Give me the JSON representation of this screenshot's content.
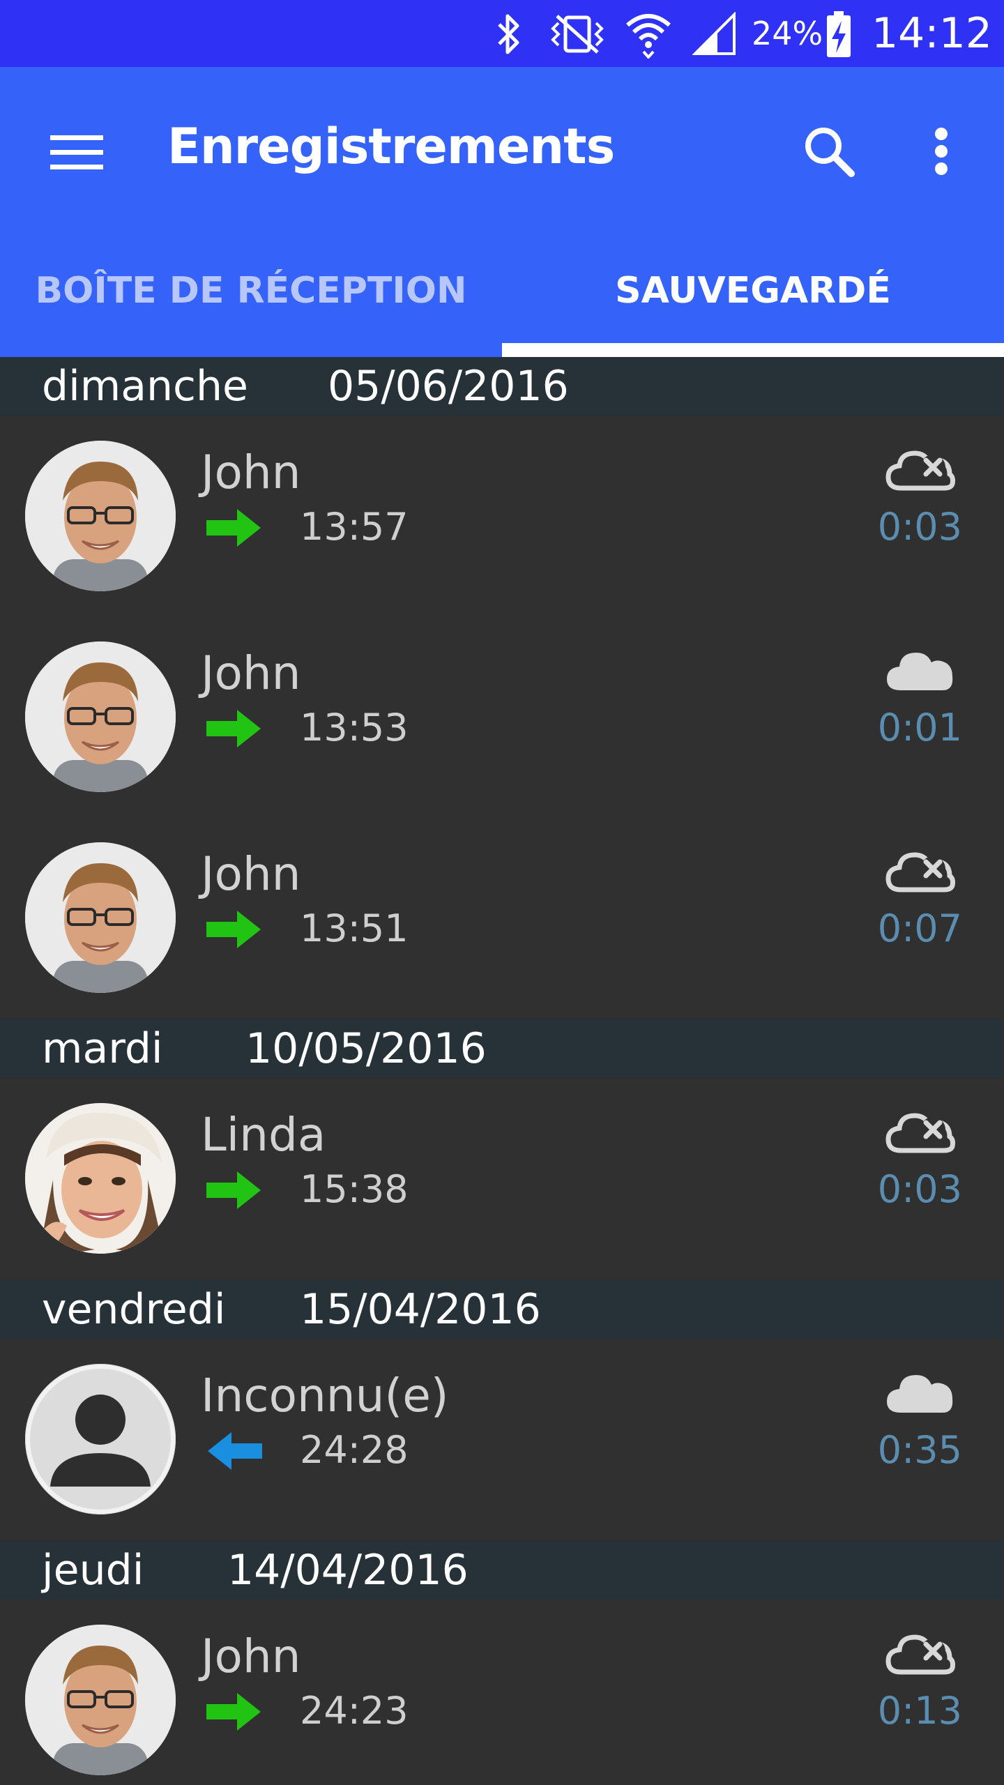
{
  "status_bar": {
    "battery": "24%",
    "time": "14:12",
    "icons": [
      "bluetooth-icon",
      "vibrate-icon",
      "wifi-icon",
      "signal-icon",
      "battery-charging-icon"
    ]
  },
  "app_bar": {
    "title": "Enregistrements",
    "icons": [
      "menu-icon",
      "search-icon",
      "more-vert-icon"
    ]
  },
  "tabs": [
    {
      "label": "BOÎTE DE RÉCEPTION",
      "active": false
    },
    {
      "label": "SAUVEGARDÉ",
      "active": true
    }
  ],
  "sections": [
    {
      "day": "dimanche",
      "date": "05/06/2016",
      "items": [
        {
          "name": "John",
          "direction": "outgoing",
          "time": "13:57",
          "cloud": "cloud-off-icon",
          "duration": "0:03"
        },
        {
          "name": "John",
          "direction": "outgoing",
          "time": "13:53",
          "cloud": "cloud-icon",
          "duration": "0:01"
        },
        {
          "name": "John",
          "direction": "outgoing",
          "time": "13:51",
          "cloud": "cloud-off-icon",
          "duration": "0:07"
        }
      ]
    },
    {
      "day": "mardi",
      "date": "10/05/2016",
      "items": [
        {
          "name": "Linda",
          "direction": "outgoing",
          "time": "15:38",
          "cloud": "cloud-off-icon",
          "duration": "0:03"
        }
      ]
    },
    {
      "day": "vendredi",
      "date": "15/04/2016",
      "items": [
        {
          "name": "Inconnu(e)",
          "direction": "incoming",
          "time": "24:28",
          "cloud": "cloud-icon",
          "duration": "0:35"
        }
      ]
    },
    {
      "day": "jeudi",
      "date": "14/04/2016",
      "items": [
        {
          "name": "John",
          "direction": "outgoing",
          "time": "24:23",
          "cloud": "cloud-off-icon",
          "duration": "0:13"
        }
      ]
    }
  ],
  "colors": {
    "status_bar": "#2f31f5",
    "app_bar": "#3563f9",
    "section_header": "#263238",
    "row_background": "#303030",
    "outgoing_arrow": "#22c414",
    "incoming_arrow": "#1a8fe0",
    "duration_text": "#5b8db0"
  }
}
